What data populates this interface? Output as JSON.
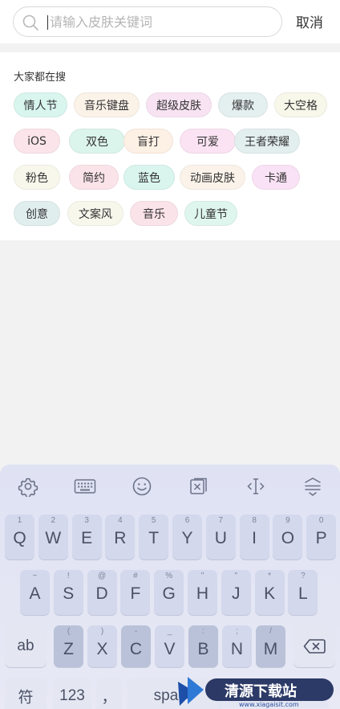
{
  "search": {
    "placeholder": "请输入皮肤关键词",
    "cancel_label": "取消"
  },
  "hot": {
    "title": "大家都在搜",
    "tags": [
      {
        "label": "情人节",
        "color": "#d8f5ee"
      },
      {
        "label": "音乐键盘",
        "color": "#fbf2e8"
      },
      {
        "label": "超级皮肤",
        "color": "#f8e3f3"
      },
      {
        "label": "爆款",
        "color": "#e4efef"
      },
      {
        "label": "大空格",
        "color": "#f7f7ea"
      },
      {
        "label": "iOS",
        "color": "#fbe4ea"
      },
      {
        "label": "双色",
        "color": "#dcf5ec"
      },
      {
        "label": "盲打",
        "color": "#fdf0e5"
      },
      {
        "label": "可爱",
        "color": "#fbe3f3"
      },
      {
        "label": "王者荣耀",
        "color": "#e3eeee"
      },
      {
        "label": "粉色",
        "color": "#f7f7eb"
      },
      {
        "label": "简约",
        "color": "#fbe3ea"
      },
      {
        "label": "蓝色",
        "color": "#d9f5ee"
      },
      {
        "label": "动画皮肤",
        "color": "#fbf3ea"
      },
      {
        "label": "卡通",
        "color": "#fae2f6"
      },
      {
        "label": "创意",
        "color": "#e1eeee"
      },
      {
        "label": "文案风",
        "color": "#f7f7ec"
      },
      {
        "label": "音乐",
        "color": "#fbe3ea"
      },
      {
        "label": "儿童节",
        "color": "#dff6ee"
      }
    ]
  },
  "keyboard": {
    "toolbar": [
      "gear-icon",
      "keyboard-icon",
      "emoji-icon",
      "clipboard-icon",
      "cursor-move-icon",
      "hide-keyboard-icon"
    ],
    "row1": [
      {
        "hint": "1",
        "key": "Q"
      },
      {
        "hint": "2",
        "key": "W"
      },
      {
        "hint": "3",
        "key": "E"
      },
      {
        "hint": "4",
        "key": "R"
      },
      {
        "hint": "5",
        "key": "T"
      },
      {
        "hint": "6",
        "key": "Y"
      },
      {
        "hint": "7",
        "key": "U"
      },
      {
        "hint": "8",
        "key": "I"
      },
      {
        "hint": "9",
        "key": "O"
      },
      {
        "hint": "0",
        "key": "P"
      }
    ],
    "row2": [
      {
        "hint": "~",
        "key": "A"
      },
      {
        "hint": "!",
        "key": "S"
      },
      {
        "hint": "@",
        "key": "D"
      },
      {
        "hint": "#",
        "key": "F"
      },
      {
        "hint": "%",
        "key": "G"
      },
      {
        "hint": "\"",
        "key": "H"
      },
      {
        "hint": "\"",
        "key": "J"
      },
      {
        "hint": "*",
        "key": "K"
      },
      {
        "hint": "?",
        "key": "L"
      }
    ],
    "shift_label": "ab",
    "row3": [
      {
        "hint": "(",
        "key": "Z"
      },
      {
        "hint": ")",
        "key": "X"
      },
      {
        "hint": "-",
        "key": "C"
      },
      {
        "hint": "_",
        "key": "V"
      },
      {
        "hint": ":",
        "key": "B"
      },
      {
        "hint": ";",
        "key": "N"
      },
      {
        "hint": "/",
        "key": "M"
      }
    ],
    "backspace_icon": "backspace-icon",
    "row4": {
      "symbol": "符",
      "num": "123",
      "comma": "，",
      "space": "space"
    }
  },
  "watermark": {
    "text": "清源下载站",
    "url": "www.xiagaisit.com"
  }
}
